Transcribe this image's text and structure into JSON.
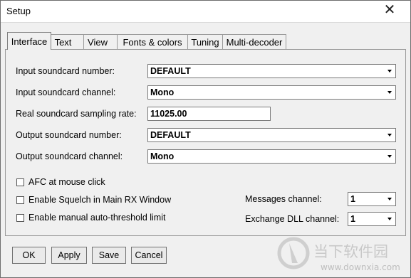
{
  "window": {
    "title": "Setup",
    "close_glyph": "✕"
  },
  "tabs": [
    {
      "label": "Interface",
      "active": true
    },
    {
      "label": "Text",
      "active": false
    },
    {
      "label": "View",
      "active": false
    },
    {
      "label": "Fonts & colors",
      "active": false
    },
    {
      "label": "Tuning",
      "active": false
    },
    {
      "label": "Multi-decoder",
      "active": false
    }
  ],
  "fields": {
    "input_soundcard_number": {
      "label": "Input soundcard number:",
      "value": "DEFAULT"
    },
    "input_soundcard_channel": {
      "label": "Input soundcard channel:",
      "value": "Mono"
    },
    "sampling_rate": {
      "label": "Real soundcard sampling rate:",
      "value": "11025.00"
    },
    "output_soundcard_number": {
      "label": "Output soundcard number:",
      "value": "DEFAULT"
    },
    "output_soundcard_channel": {
      "label": "Output soundcard channel:",
      "value": "Mono"
    }
  },
  "checkboxes": {
    "afc": {
      "label": "AFC at mouse click",
      "checked": false
    },
    "squelch": {
      "label": "Enable Squelch in Main RX Window",
      "checked": false
    },
    "auto_threshold": {
      "label": "Enable manual auto-threshold limit",
      "checked": false
    }
  },
  "channels": {
    "messages": {
      "label": "Messages channel:",
      "value": "1"
    },
    "exchange_dll": {
      "label": "Exchange DLL channel:",
      "value": "1"
    }
  },
  "buttons": {
    "ok": "OK",
    "apply": "Apply",
    "save": "Save",
    "cancel": "Cancel"
  },
  "watermark": {
    "text_cn": "当下软件园",
    "url": "www.downxia.com"
  }
}
